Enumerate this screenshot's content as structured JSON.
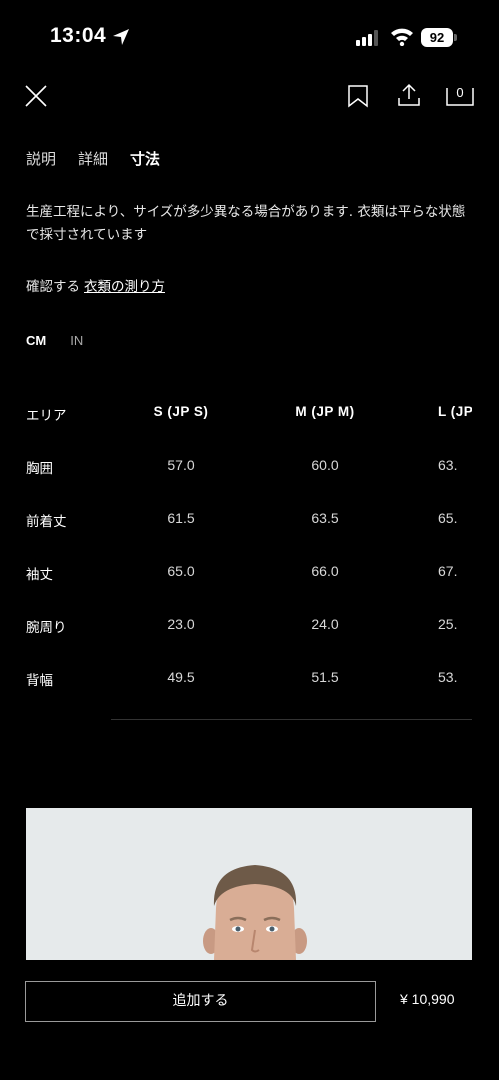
{
  "status_bar": {
    "time": "13:04",
    "battery": "92"
  },
  "header": {
    "icons": [
      "close-icon",
      "bookmark-icon",
      "share-icon",
      "cart-icon"
    ],
    "cart_count": "0"
  },
  "tabs": [
    {
      "label": "説明",
      "active": false
    },
    {
      "label": "詳細",
      "active": false
    },
    {
      "label": "寸法",
      "active": true
    }
  ],
  "note": "生産工程により、サイズが多少異なる場合があります. 衣類は平らな状態で採寸されています",
  "check": {
    "prefix": "確認する",
    "link": "衣類の測り方"
  },
  "units": [
    {
      "label": "CM",
      "active": true
    },
    {
      "label": "IN",
      "active": false
    }
  ],
  "size_table": {
    "headers": [
      "エリア",
      "S (JP S)",
      "M (JP M)",
      "L (JP"
    ],
    "rows": [
      {
        "area": "胸囲",
        "values": [
          "57.0",
          "60.0",
          "63."
        ]
      },
      {
        "area": "前着丈",
        "values": [
          "61.5",
          "63.5",
          "65."
        ]
      },
      {
        "area": "袖丈",
        "values": [
          "65.0",
          "66.0",
          "67."
        ]
      },
      {
        "area": "腕周り",
        "values": [
          "23.0",
          "24.0",
          "25."
        ]
      },
      {
        "area": "背幅",
        "values": [
          "49.5",
          "51.5",
          "53."
        ]
      }
    ]
  },
  "footer": {
    "add_label": "追加する",
    "price": "¥  10,990"
  },
  "colors": {
    "background": "#000000",
    "text": "#ffffff",
    "button_border": "#9a9a9a"
  }
}
